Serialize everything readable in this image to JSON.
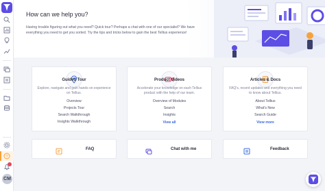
{
  "header": {
    "title": "How can we help you?",
    "intro": "Having trouble figuring out what you need? Quick tour? Perhaps a chat with one of our specialist? We have everything you need to get you sorted. Try the tips and tricks below to gain the best Tellius experience!"
  },
  "cards": [
    {
      "title": "Guided Tour",
      "description": "Explore, navigate and gain hands on experience on Tellius.",
      "icon": "location-pin-icon",
      "links": [
        "Overview",
        "Projects Tour",
        "Search Walkthrough",
        "Insights Walkthrough"
      ]
    },
    {
      "title": "Product Videos",
      "description": "Accelerate your knowledge on each Tellius product with the help of our team.",
      "icon": "video-camera-icon",
      "links": [
        "Overview of Modules",
        "Search",
        "Insights"
      ],
      "more": "View all"
    },
    {
      "title": "Articles & Docs",
      "description": "FAQ's, recent updates and everything you need to know about Tellius.",
      "icon": "document-icon",
      "links": [
        "About Tellius",
        "What's New",
        "Search Guide"
      ],
      "more": "View more"
    }
  ],
  "bottom": {
    "faq": "FAQ",
    "chat": "Chat with me",
    "feedback": "Feedback"
  },
  "sidebar": {
    "avatar": "CM"
  },
  "colors": {
    "brand": "#5c4ee5",
    "accent_orange": "#f6a23b",
    "link_blue": "#3a6ae0"
  }
}
